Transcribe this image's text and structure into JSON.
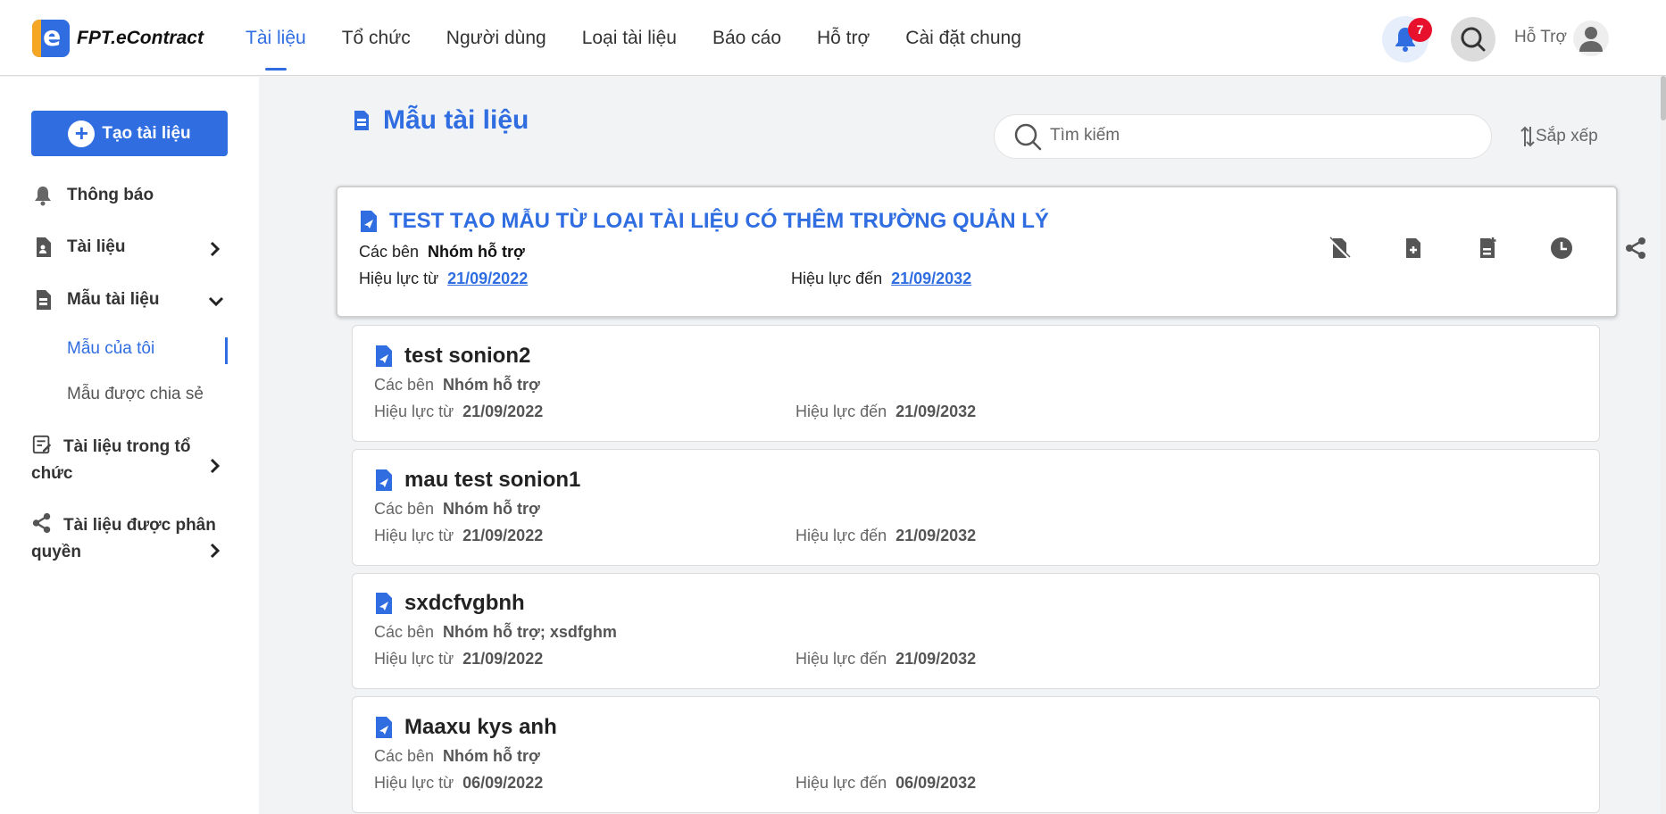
{
  "brand": {
    "name": "FPT.eContract",
    "logo_letter": "e"
  },
  "nav": {
    "items": [
      {
        "label": "Tài liệu",
        "active": true
      },
      {
        "label": "Tổ chức"
      },
      {
        "label": "Người dùng"
      },
      {
        "label": "Loại tài liệu"
      },
      {
        "label": "Báo cáo"
      },
      {
        "label": "Hỗ trợ"
      },
      {
        "label": "Cài đặt chung"
      }
    ]
  },
  "header": {
    "notification_count": "7",
    "user_name": "Hỗ Trợ"
  },
  "sidebar": {
    "create_label": "Tạo tài liệu",
    "items": [
      {
        "label": "Thông báo",
        "icon": "bell-icon"
      },
      {
        "label": "Tài liệu",
        "icon": "document-user-icon"
      },
      {
        "label": "Mẫu tài liệu",
        "icon": "template-icon"
      },
      {
        "label": "Tài liệu trong tổ chức",
        "icon": "document-edit-icon"
      },
      {
        "label": "Tài liệu được phân quyền",
        "icon": "share-icon"
      }
    ],
    "sub_items": [
      {
        "label": "Mẫu của tôi",
        "active": true
      },
      {
        "label": "Mẫu được chia sẻ"
      }
    ]
  },
  "main": {
    "title": "Mẫu tài liệu",
    "search_placeholder": "Tìm kiếm",
    "sort_label": "Sắp xếp",
    "labels": {
      "parties": "Các bên",
      "valid_from": "Hiệu lực từ",
      "valid_to": "Hiệu lực đến"
    },
    "templates": [
      {
        "title": "TEST TẠO MẪU TỪ LOẠI TÀI LIỆU CÓ THÊM TRƯỜNG QUẢN LÝ",
        "parties": "Nhóm hỗ trợ",
        "from": "21/09/2022",
        "to": "21/09/2032"
      },
      {
        "title": "test sonion2",
        "parties": "Nhóm hỗ trợ",
        "from": "21/09/2022",
        "to": "21/09/2032"
      },
      {
        "title": "mau test sonion1",
        "parties": "Nhóm hỗ trợ",
        "from": "21/09/2022",
        "to": "21/09/2032"
      },
      {
        "title": "sxdcfvgbnh",
        "parties": "Nhóm hỗ trợ; xsdfghm",
        "from": "21/09/2022",
        "to": "21/09/2032"
      },
      {
        "title": "Maaxu kys anh",
        "parties": "Nhóm hỗ trợ",
        "from": "06/09/2022",
        "to": "06/09/2032"
      }
    ],
    "card_actions": [
      "disable-document-icon",
      "add-document-icon",
      "add-template-icon",
      "history-clock-icon",
      "share-icon"
    ]
  },
  "colors": {
    "primary": "#2f6de1",
    "badge": "#e8112d",
    "accent": "#f5a623"
  }
}
